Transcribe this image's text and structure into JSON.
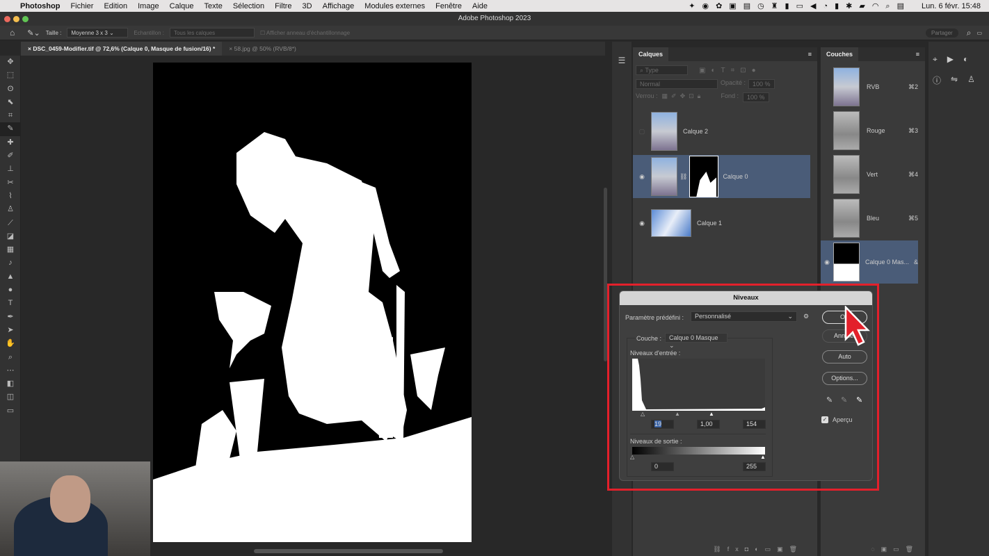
{
  "menubar": {
    "app": "Photoshop",
    "items": [
      "Fichier",
      "Edition",
      "Image",
      "Calque",
      "Texte",
      "Sélection",
      "Filtre",
      "3D",
      "Affichage",
      "Modules externes",
      "Fenêtre",
      "Aide"
    ],
    "datetime": "Lun. 6 févr.  15:48"
  },
  "window": {
    "title": "Adobe Photoshop 2023"
  },
  "options": {
    "size_label": "Taille :",
    "size_value": "Moyenne 3 x 3",
    "sample_label": "Echantillon :",
    "sample_value": "Tous les calques",
    "ring_label": "Afficher anneau d'échantillonnage",
    "share": "Partager"
  },
  "tabs": [
    {
      "label": "DSC_0459-Modifier.tif @ 72,6% (Calque 0, Masque de fusion/16) *"
    },
    {
      "label": "58.jpg @ 50% (RVB/8*)"
    }
  ],
  "layers_panel": {
    "title": "Calques",
    "filter": "Type",
    "blend": "Normal",
    "opacity_label": "Opacité :",
    "opacity": "100 %",
    "lock_label": "Verrou :",
    "fill_label": "Fond :",
    "fill": "100 %",
    "layers": [
      {
        "name": "Calque 2",
        "visible": false
      },
      {
        "name": "Calque 0",
        "visible": true,
        "selected": true
      },
      {
        "name": "Calque 1",
        "visible": true
      }
    ]
  },
  "channels_panel": {
    "title": "Couches",
    "channels": [
      {
        "name": "RVB",
        "shortcut": "⌘2"
      },
      {
        "name": "Rouge",
        "shortcut": "⌘3"
      },
      {
        "name": "Vert",
        "shortcut": "⌘4"
      },
      {
        "name": "Bleu",
        "shortcut": "⌘5"
      },
      {
        "name": "Calque 0 Mas...",
        "shortcut": "&",
        "selected": true
      }
    ]
  },
  "levels_dialog": {
    "title": "Niveaux",
    "preset_label": "Paramètre prédéfini :",
    "preset": "Personnalisé",
    "channel_label": "Couche :",
    "channel": "Calque 0 Masque",
    "input_label": "Niveaux d'entrée :",
    "input_black": "19",
    "input_gamma": "1,00",
    "input_white": "154",
    "output_label": "Niveaux de sortie :",
    "output_black": "0",
    "output_white": "255",
    "ok": "OK",
    "cancel": "Annuler",
    "auto": "Auto",
    "options": "Options...",
    "preview_label": "Aperçu",
    "preview_checked": true
  },
  "colors": {
    "accent_red": "#e3202b",
    "selected_layer": "#4a5c78"
  }
}
